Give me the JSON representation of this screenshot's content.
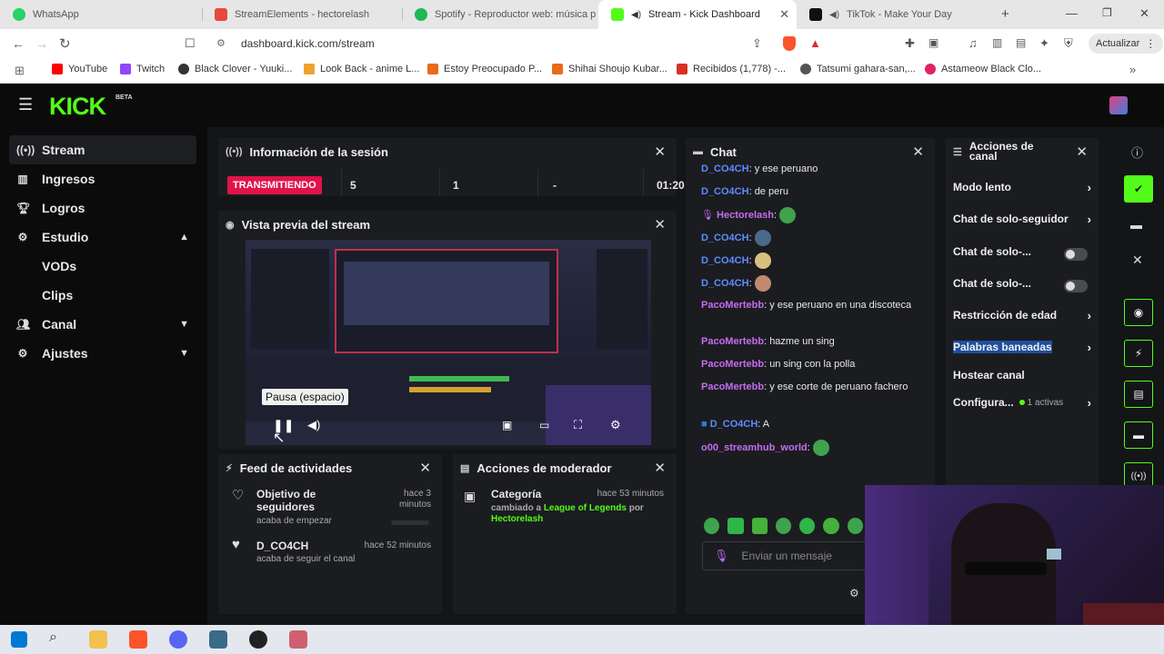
{
  "browser": {
    "tabs": [
      {
        "title": "WhatsApp",
        "icon": "whatsapp-icon",
        "color": "#25d366"
      },
      {
        "title": "StreamElements - hectorelash",
        "icon": "streamelements-icon",
        "color": "#e64a3a"
      },
      {
        "title": "Spotify - Reproductor web: música p",
        "icon": "spotify-icon",
        "color": "#1db954"
      },
      {
        "title": "Stream - Kick Dashboard",
        "icon": "kick-icon",
        "color": "#53fc18",
        "active": true
      },
      {
        "title": "TikTok - Make Your Day",
        "icon": "tiktok-icon",
        "color": "#111111"
      }
    ],
    "url": "dashboard.kick.com/stream",
    "update_button": "Actualizar",
    "bookmarks": [
      {
        "title": "YouTube",
        "color": "#ff0000"
      },
      {
        "title": "Twitch",
        "color": "#9146ff"
      },
      {
        "title": "Black Clover - Yuuki...",
        "color": "#333333"
      },
      {
        "title": "Look Back - anime L...",
        "color": "#f0a030"
      },
      {
        "title": "Estoy Preocupado P...",
        "color": "#e86a1a"
      },
      {
        "title": "Shihai Shoujo Kubar...",
        "color": "#e86a1a"
      },
      {
        "title": "Recibidos (1,778) -...",
        "color": "#d93025"
      },
      {
        "title": "Tatsumi gahara-san,...",
        "color": "#555555"
      },
      {
        "title": "Astameow Black Clo...",
        "color": "#e0245e"
      }
    ]
  },
  "app": {
    "logo": "KICK",
    "logo_beta": "BETA",
    "accent": "#53fc18",
    "sidebar": [
      {
        "label": "Stream",
        "icon": "broadcast-icon",
        "active": true
      },
      {
        "label": "Ingresos",
        "icon": "chart-icon"
      },
      {
        "label": "Logros",
        "icon": "trophy-icon"
      },
      {
        "label": "Estudio",
        "icon": "palette-icon",
        "chevron": "up"
      },
      {
        "label": "VODs",
        "sub": true
      },
      {
        "label": "Clips",
        "sub": true
      },
      {
        "label": "Canal",
        "icon": "users-icon",
        "chevron": "down"
      },
      {
        "label": "Ajustes",
        "icon": "gear-icon",
        "chevron": "down"
      }
    ],
    "session": {
      "title": "Información de la sesión",
      "status": "TRANSMITIENDO",
      "viewers": "5",
      "followers": "1",
      "subs": "-",
      "time": "01:20"
    },
    "preview": {
      "title": "Vista previa del stream",
      "tooltip": "Pausa (espacio)"
    },
    "activity": {
      "title": "Feed de actividades",
      "items": [
        {
          "title": "Objetivo de seguidores",
          "sub": "acaba de empezar",
          "time": "hace 3 minutos"
        },
        {
          "title": "D_CO4CH",
          "sub": "acaba de seguir el canal",
          "time": "hace 52 minutos"
        }
      ]
    },
    "moderator": {
      "title": "Acciones de moderador",
      "item_title": "Categoría",
      "item_time": "hace 53 minutos",
      "changed": "cambiado a",
      "category": "League of Legends",
      "by": "por",
      "author": "Hectorelash"
    },
    "chat": {
      "title": "Chat",
      "placeholder": "Enviar un mensaje",
      "messages": [
        {
          "user": "D_CO4CH",
          "text": ": y ese peruano",
          "color": "blue"
        },
        {
          "user": "D_CO4CH",
          "text": ": de peru",
          "color": "blue"
        },
        {
          "user": "Hectorelash",
          "text": ":",
          "color": "purple",
          "emote": "#3fa34d"
        },
        {
          "user": "D_CO4CH",
          "text": ":",
          "color": "blue",
          "emote": "#4a6a8a"
        },
        {
          "user": "D_CO4CH",
          "text": ":",
          "color": "blue",
          "emote": "#d8c080"
        },
        {
          "user": "D_CO4CH",
          "text": ":",
          "color": "blue",
          "emote": "#c08a70"
        },
        {
          "user": "PacoMertebb",
          "text": ": y ese peruano en una discoteca",
          "color": "purple"
        },
        {
          "user": "PacoMertebb",
          "text": ": hazme un sing",
          "color": "purple"
        },
        {
          "user": "PacoMertebb",
          "text": ": un sing con la polla",
          "color": "purple"
        },
        {
          "user": "PacoMertebb",
          "text": ": y ese corte de peruano fachero",
          "color": "purple"
        },
        {
          "user": "D_CO4CH",
          "text": ": A",
          "color": "blue"
        },
        {
          "user": "o00_streamhub_world",
          "text": ":",
          "color": "purple",
          "emote": "#3fa34d"
        }
      ]
    },
    "channel_actions": {
      "title": "Acciones de canal",
      "rows": [
        {
          "label": "Modo lento",
          "type": "chevron"
        },
        {
          "label": "Chat de solo-seguidor",
          "type": "chevron"
        },
        {
          "label": "Chat de solo-...",
          "type": "toggle"
        },
        {
          "label": "Chat de solo-...",
          "type": "toggle"
        },
        {
          "label": "Restricción de edad",
          "type": "chevron"
        },
        {
          "label": "Palabras baneadas",
          "type": "chevron",
          "highlight": true
        },
        {
          "label": "Hostear canal",
          "type": "none"
        },
        {
          "label": "Configura...",
          "type": "chevron",
          "badge": "1 activas"
        }
      ]
    }
  }
}
